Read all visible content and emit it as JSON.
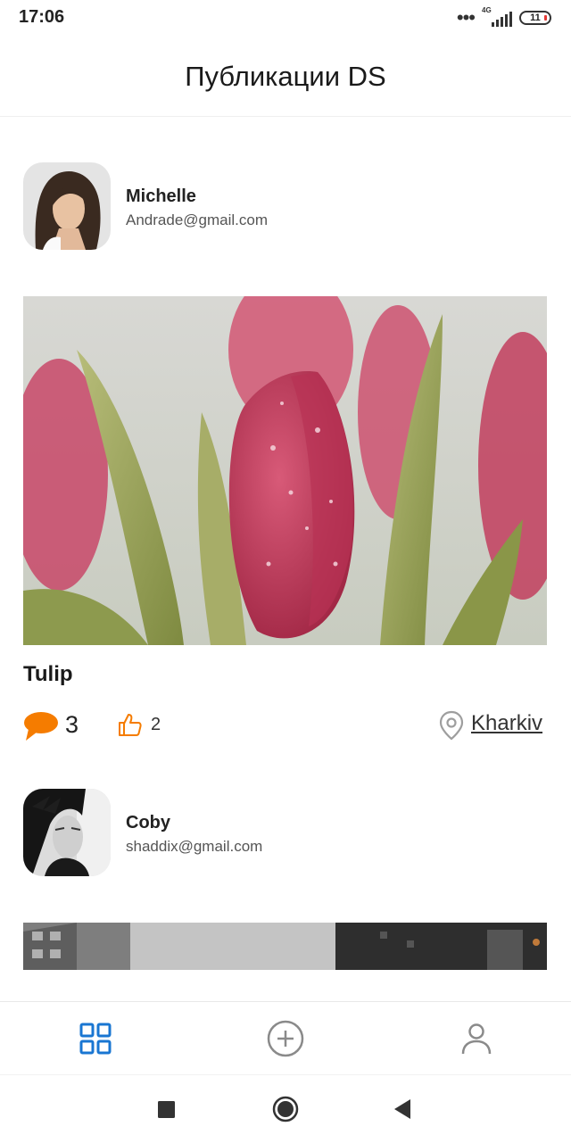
{
  "status_bar": {
    "time": "17:06",
    "network": "4G",
    "battery": "11"
  },
  "header": {
    "title": "Публикации DS"
  },
  "posts": [
    {
      "author_name": "Michelle",
      "author_email": "Andrade@gmail.com",
      "title": "Tulip",
      "comments": "3",
      "likes": "2",
      "location": "Kharkiv"
    },
    {
      "author_name": "Coby",
      "author_email": "shaddix@gmail.com"
    }
  ],
  "icons": {
    "comment": "speech-bubble-icon",
    "like": "thumbs-up-icon",
    "location": "map-pin-icon",
    "nav": [
      "grid-icon",
      "add-circle-icon",
      "profile-icon"
    ],
    "system": [
      "square-recents-icon",
      "circle-home-icon",
      "triangle-back-icon"
    ]
  },
  "colors": {
    "accent_blue": "#1976d2",
    "accent_orange": "#f57c00",
    "icon_gray": "#888888"
  }
}
